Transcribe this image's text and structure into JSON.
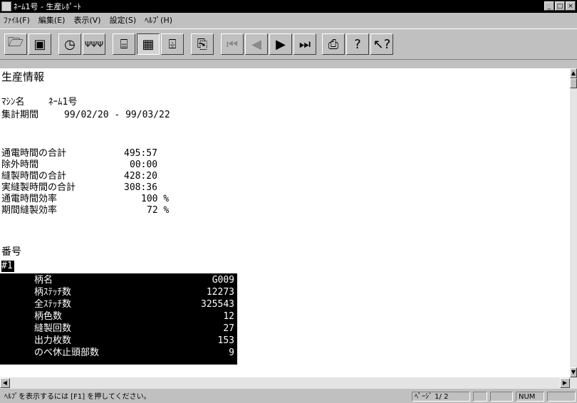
{
  "window": {
    "title": "ﾈｰﾑ1号 - 生産ﾚﾎﾟｰﾄ"
  },
  "menu": [
    "ﾌｧｲﾙ(F)",
    "編集(E)",
    "表示(V)",
    "設定(S)",
    "ﾍﾙﾌﾟ(H)"
  ],
  "toolbar": {
    "icons": [
      "open-folder-icon",
      "save-disk-icon",
      "clock-icon",
      "stitch-pattern-icon",
      "machine-sewing-icon",
      "production-grid-icon",
      "multi-head-icon",
      "copy-report-icon",
      "first-page-icon",
      "prev-page-icon",
      "next-page-icon",
      "last-page-icon",
      "print-icon",
      "help-icon",
      "context-help-icon"
    ]
  },
  "report": {
    "heading": "生産情報",
    "machine_label": "ﾏｼﾝ名",
    "machine_value": "ﾈｰﾑ1号",
    "period_label": "集計期間",
    "period_value": "99/02/20 - 99/03/22",
    "stats": [
      {
        "label": "通電時間の合計",
        "value": "495:57"
      },
      {
        "label": "除外時間",
        "value": "00:00"
      },
      {
        "label": "縫製時間の合計",
        "value": "428:20"
      },
      {
        "label": "実縫製時間の合計",
        "value": "308:36"
      },
      {
        "label": "通電時間効率",
        "value": "100 %"
      },
      {
        "label": "期間縫製効率",
        "value": "72 %"
      }
    ],
    "number_label": "番号",
    "number_value": "#1",
    "pattern_rows": [
      {
        "label": "柄名",
        "value": "G009"
      },
      {
        "label": "柄ｽﾃｯﾁ数",
        "value": "12273"
      },
      {
        "label": "全ｽﾃｯﾁ数",
        "value": "325543"
      },
      {
        "label": "柄色数",
        "value": "12"
      },
      {
        "label": "縫製回数",
        "value": "27"
      },
      {
        "label": "出力枚数",
        "value": "153"
      },
      {
        "label": "のべ休止頭部数",
        "value": "9"
      }
    ]
  },
  "status": {
    "help_text": "ﾍﾙﾌﾟを表示するには [F1] を押してください。",
    "page_text": "ﾍﾟｰｼﾞ 1/ 2",
    "num": "NUM"
  }
}
